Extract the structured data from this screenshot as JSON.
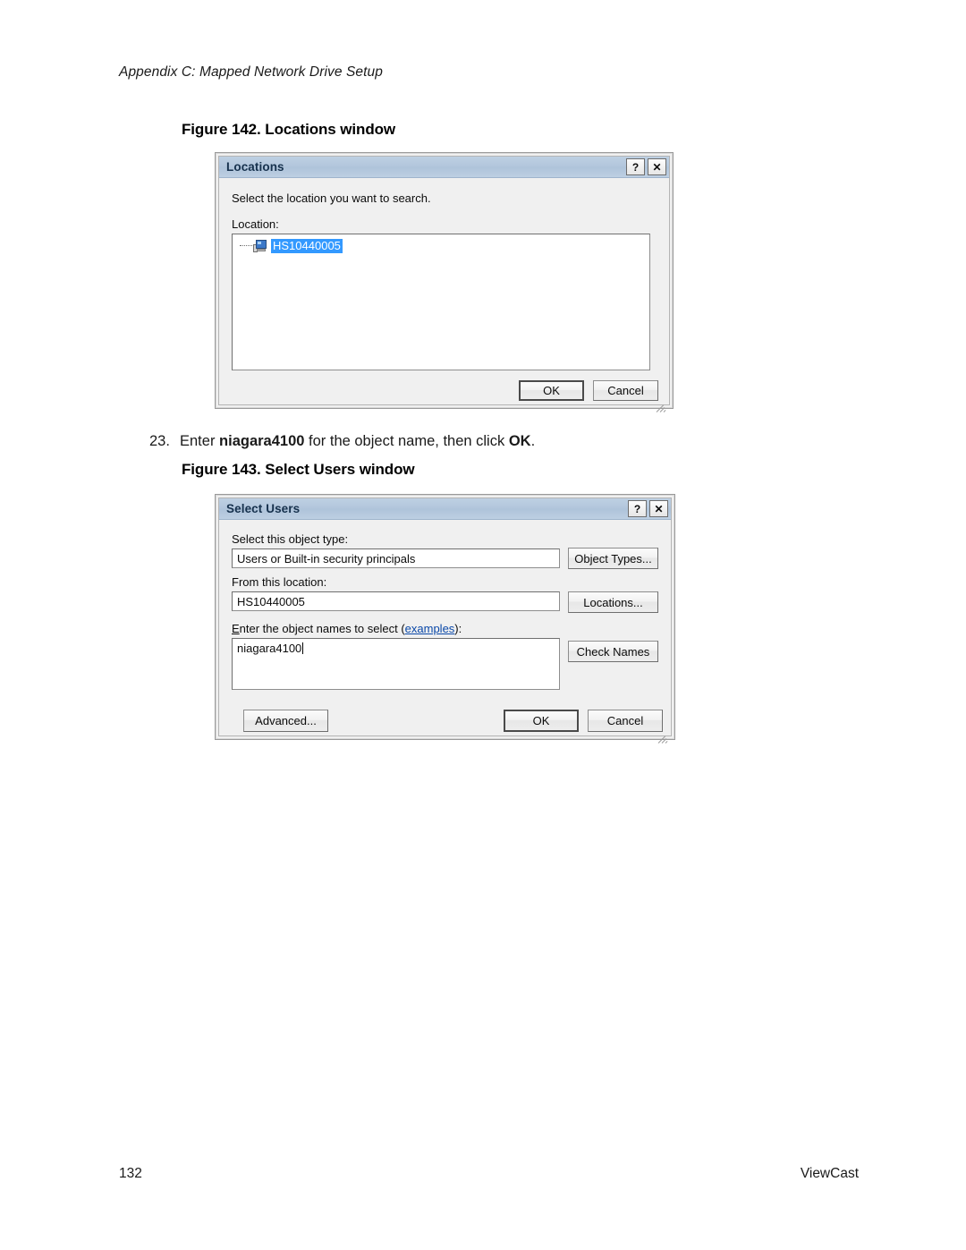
{
  "page": {
    "running_header": "Appendix C: Mapped Network Drive Setup",
    "page_number": "132",
    "brand": "ViewCast"
  },
  "figures": {
    "fig142_caption": "Figure 142. Locations window",
    "fig143_caption": "Figure 143. Select Users window"
  },
  "step": {
    "number": "23.",
    "text_before": "Enter ",
    "object_name": "niagara4100",
    "text_middle": " for the object name, then click ",
    "action": "OK",
    "text_after": "."
  },
  "locations_dialog": {
    "title": "Locations",
    "help_button": "?",
    "close_button": "✕",
    "instruction": "Select the location you want to search.",
    "location_label": "Location:",
    "tree_items": [
      {
        "label": "HS10440005",
        "icon": "computer-icon",
        "selected": true
      }
    ],
    "ok_label": "OK",
    "cancel_label": "Cancel"
  },
  "select_users_dialog": {
    "title": "Select Users",
    "help_button": "?",
    "close_button": "✕",
    "object_type_label": "Select this object type:",
    "object_type_value": "Users or Built-in security principals",
    "object_types_button": "Object Types...",
    "from_location_label": "From this location:",
    "from_location_value": "HS10440005",
    "locations_button": "Locations...",
    "object_names_label_pre": "E",
    "object_names_label_mid": "nter the object names to select (",
    "object_names_link": "examples",
    "object_names_label_post": "):",
    "object_names_value": "niagara4100",
    "check_names_button": "Check Names",
    "advanced_button": "Advanced...",
    "ok_label": "OK",
    "cancel_label": "Cancel"
  },
  "colors": {
    "titlebar_blue": "#b2c6dc",
    "selection_blue": "#3399ff",
    "link_blue": "#0a48a8",
    "dialog_face": "#f0f0f0"
  }
}
